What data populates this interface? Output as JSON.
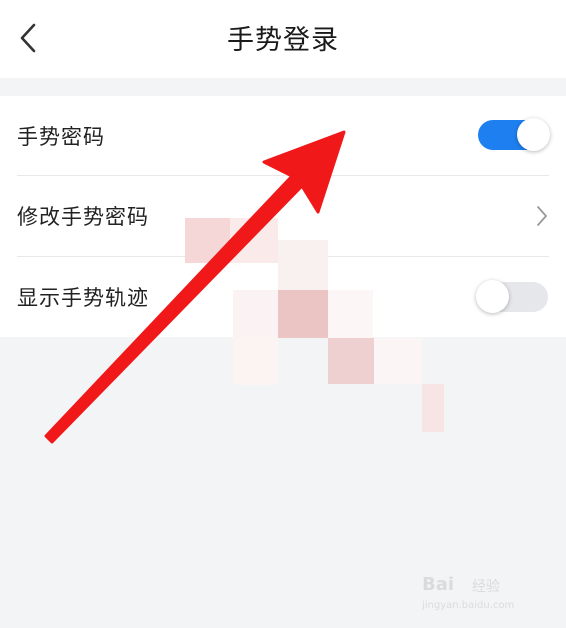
{
  "header": {
    "title": "手势登录",
    "back_icon": "chevron-left-icon"
  },
  "settings": [
    {
      "label": "手势密码",
      "control": "toggle",
      "state": "on"
    },
    {
      "label": "修改手势密码",
      "control": "chevron",
      "icon": "chevron-right-icon"
    },
    {
      "label": "显示手势轨迹",
      "control": "toggle",
      "state": "off"
    }
  ],
  "colors": {
    "accent": "#1e7ff0",
    "toggle_off": "#e6e7eb",
    "background": "#f3f4f6",
    "annotation_arrow": "#f01818"
  },
  "watermark": {
    "brand": "Bai",
    "sub": "经验",
    "url": "jingyan.baidu.com"
  }
}
